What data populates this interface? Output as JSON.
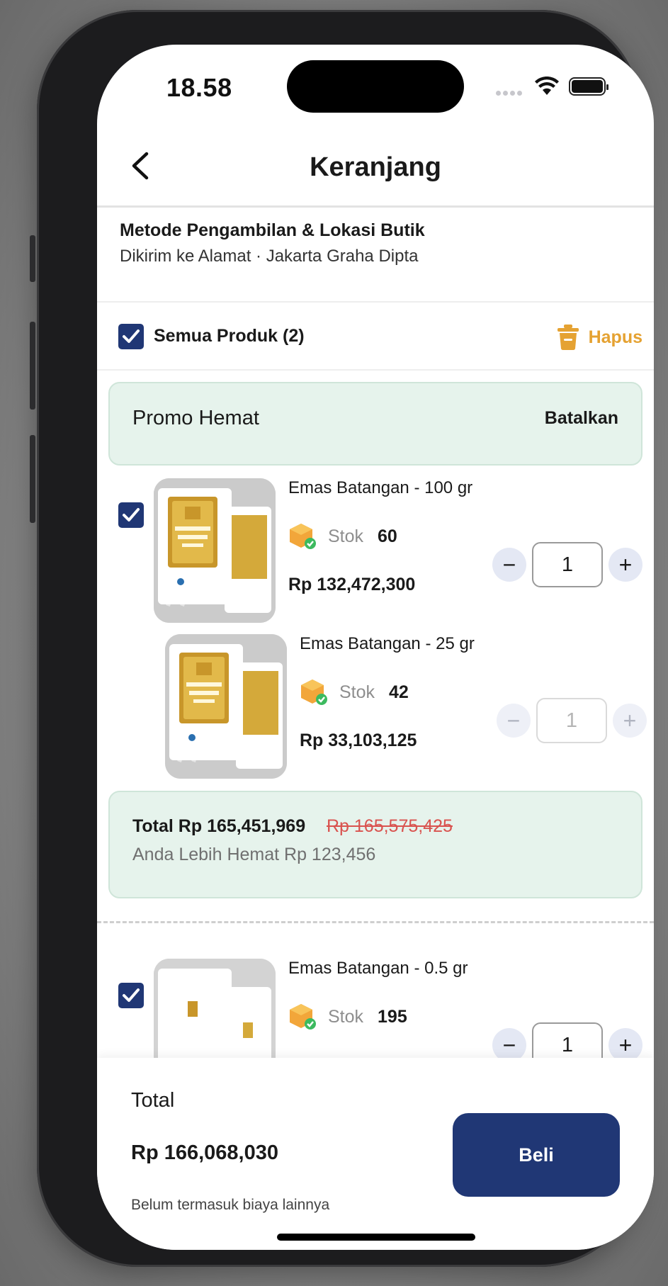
{
  "status": {
    "time": "18.58"
  },
  "header": {
    "title": "Keranjang"
  },
  "pickup": {
    "heading": "Metode Pengambilan & Lokasi Butik",
    "detail": "Dikirim ke Alamat · Jakarta Graha Dipta"
  },
  "select_all": {
    "label": "Semua Produk (2)",
    "delete_label": "Hapus",
    "checked": true
  },
  "promo": {
    "name": "Promo Hemat",
    "cancel_label": "Batalkan"
  },
  "items": [
    {
      "name": "Emas Batangan - 100 gr",
      "stock_label": "Stok",
      "stock": "60",
      "price": "Rp 132,472,300",
      "qty": "1",
      "checked": true,
      "enabled": true
    },
    {
      "name": "Emas Batangan - 25 gr",
      "stock_label": "Stok",
      "stock": "42",
      "price": "Rp 33,103,125",
      "qty": "1",
      "checked": false,
      "enabled": false
    },
    {
      "name": "Emas Batangan - 0.5 gr",
      "stock_label": "Stok",
      "stock": "195",
      "price": "",
      "qty": "1",
      "checked": true,
      "enabled": true
    }
  ],
  "promo_summary": {
    "total": "Total Rp 165,451,969",
    "original": "Rp 165,575,425",
    "savings": "Anda Lebih Hemat Rp 123,456"
  },
  "footer": {
    "total_label": "Total",
    "total_amount": "Rp 166,068,030",
    "note": "Belum termasuk biaya lainnya",
    "buy_label": "Beli"
  },
  "colors": {
    "primary": "#203775",
    "accent": "#E5A232",
    "promo_bg": "#E6F3EC",
    "strike": "#d9534f"
  },
  "icons": [
    "back-chevron-icon",
    "trash-icon",
    "check-icon",
    "stock-box-icon",
    "minus-icon",
    "plus-icon",
    "wifi-icon",
    "battery-icon",
    "cellular-icon"
  ]
}
